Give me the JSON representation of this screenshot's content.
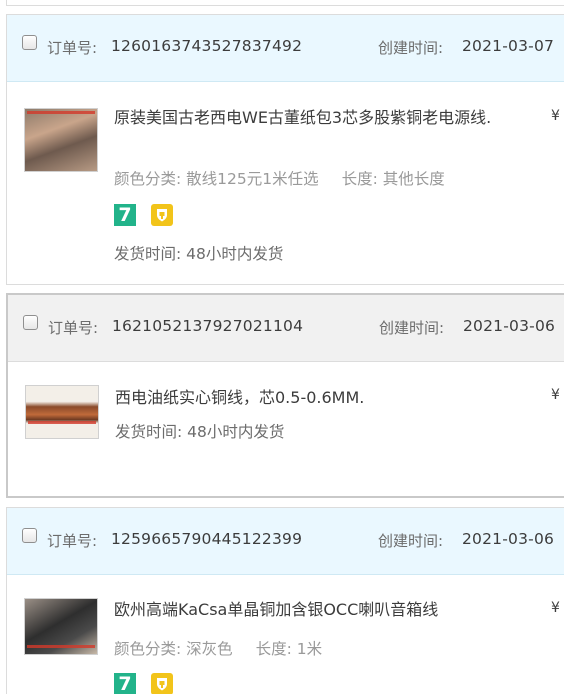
{
  "labels": {
    "order_number": "订单号:",
    "created_time": "创建时间:",
    "color_category": "颜色分类:",
    "length": "长度:",
    "ship_time": "发货时间:"
  },
  "orders": [
    {
      "order_number": "1260163743527837492",
      "created": "2021-03-07",
      "title": "原装美国古老西电WE古董纸包3芯多股紫铜老电源线.",
      "color": "散线125元1米任选",
      "length": "其他长度",
      "ship": "48小时内发货",
      "price_symbol": "¥",
      "badges": [
        "seven-day-return-icon",
        "consumer-protection-icon"
      ],
      "badge_text": "7"
    },
    {
      "order_number": "1621052137927021104",
      "created": "2021-03-06",
      "title": "西电油纸实心铜线，芯0.5-0.6MM.",
      "ship": "48小时内发货",
      "price_symbol": "¥"
    },
    {
      "order_number": "1259665790445122399",
      "created": "2021-03-06",
      "title": "欧州高端KaCsa单晶铜加含银OCC喇叭音箱线",
      "color": "深灰色",
      "length": "1米",
      "price_symbol": "¥",
      "badges": [
        "seven-day-return-icon",
        "consumer-protection-icon"
      ],
      "badge_text": "7"
    }
  ],
  "colors": {
    "header_blue": "#eaf8ff",
    "header_gray": "#f1f1f1",
    "badge_green": "#22b38a",
    "badge_yellow": "#f2c41a"
  }
}
